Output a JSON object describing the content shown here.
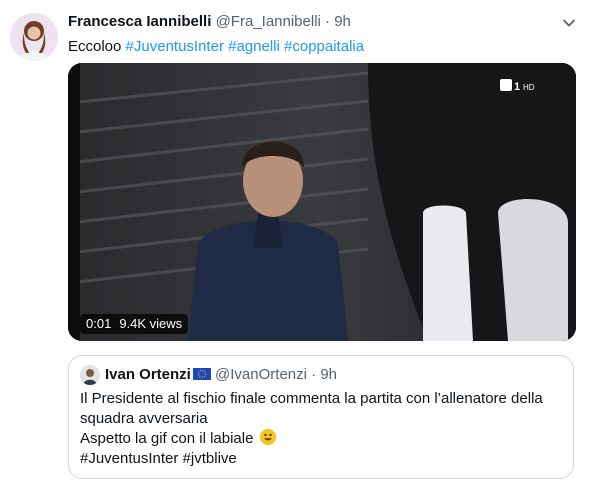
{
  "tweet": {
    "author_name": "Francesca Iannibelli",
    "handle": "@Fra_Iannibelli",
    "separator": "·",
    "time": "9h",
    "text_prefix": "Eccoloo ",
    "hashtags": [
      "#JuventusInter",
      "#agnelli",
      "#coppaitalia"
    ],
    "more_icon": "chevron-down-icon"
  },
  "media": {
    "type": "gif-video",
    "channel_logo": "Rai 1 HD",
    "duration": "0:01",
    "views": "9.4K views"
  },
  "quote": {
    "author_name": "Ivan Ortenzi",
    "flag": "EU-flag-emoji",
    "handle": "@IvanOrtenzi",
    "separator": "·",
    "time": "9h",
    "lines": [
      "Il Presidente al fischio finale commenta la partita con l’allenatore della",
      "squadra avversaria",
      "Aspetto la gif con il labiale"
    ],
    "emoji": "smiling-face-emoji",
    "hashtags_line": "#JuventusInter #jvtblive"
  },
  "colors": {
    "link": "#1d9bf0",
    "secondary_text": "#536471",
    "border": "#cfd9de"
  }
}
